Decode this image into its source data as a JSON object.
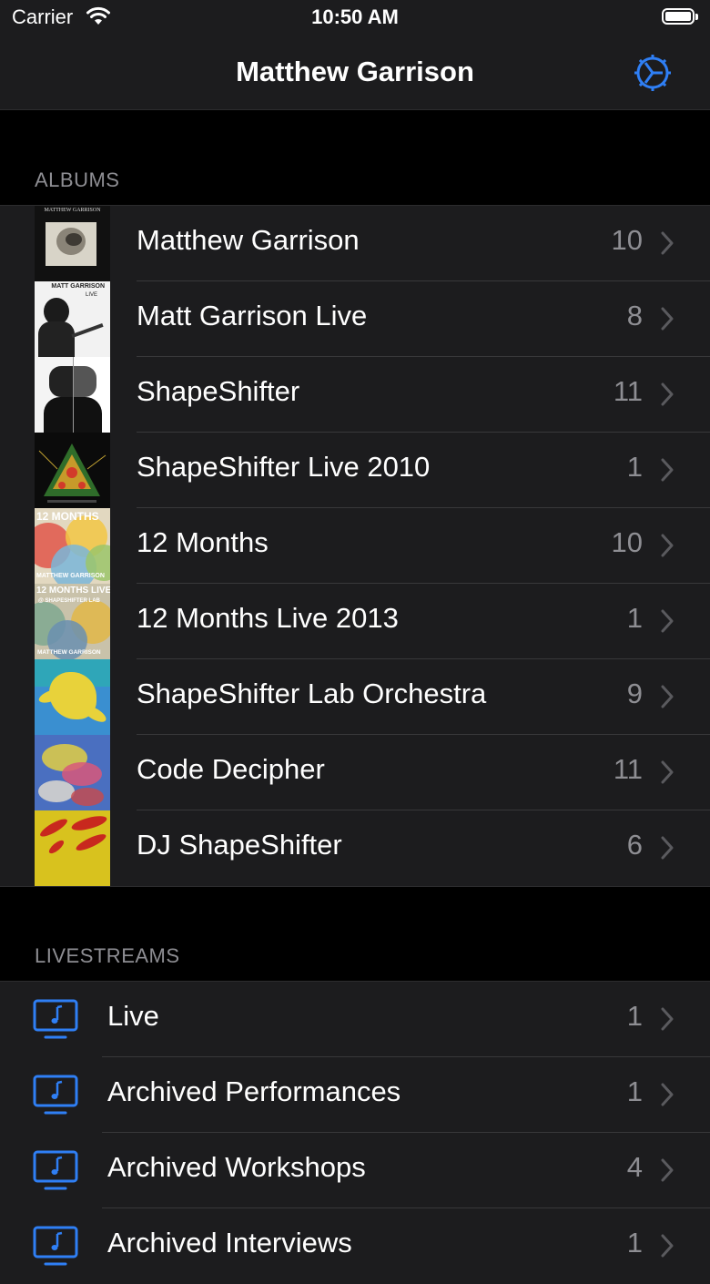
{
  "status": {
    "carrier": "Carrier",
    "time": "10:50 AM"
  },
  "nav": {
    "title": "Matthew Garrison"
  },
  "sections": {
    "albums": {
      "header": "ALBUMS",
      "items": [
        {
          "label": "Matthew Garrison",
          "count": "10"
        },
        {
          "label": "Matt Garrison Live",
          "count": "8"
        },
        {
          "label": "ShapeShifter",
          "count": "11"
        },
        {
          "label": "ShapeShifter Live 2010",
          "count": "1"
        },
        {
          "label": "12 Months",
          "count": "10"
        },
        {
          "label": "12 Months Live 2013",
          "count": "1"
        },
        {
          "label": "ShapeShifter Lab Orchestra",
          "count": "9"
        },
        {
          "label": "Code Decipher",
          "count": "11"
        },
        {
          "label": "DJ ShapeShifter",
          "count": "6"
        }
      ],
      "art_text": {
        "a1_top": "MATTHEW GARRISON",
        "a2_top": "MATT GARRISON",
        "a2_sub": "LIVE",
        "a5_top": "12 MONTHS",
        "a5_bottom": "MATTHEW GARRISON",
        "a6_top": "12 MONTHS LIVE",
        "a6_sub": "@ SHAPESHIFTER LAB",
        "a6_bottom": "MATTHEW GARRISON"
      }
    },
    "livestreams": {
      "header": "LIVESTREAMS",
      "items": [
        {
          "label": "Live",
          "count": "1"
        },
        {
          "label": "Archived Performances",
          "count": "1"
        },
        {
          "label": "Archived Workshops",
          "count": "4"
        },
        {
          "label": "Archived Interviews",
          "count": "1"
        }
      ]
    }
  },
  "colors": {
    "accent": "#2f7ff5",
    "background": "#000000",
    "cell": "#1c1c1e",
    "secondary_text": "#8e8e93"
  }
}
